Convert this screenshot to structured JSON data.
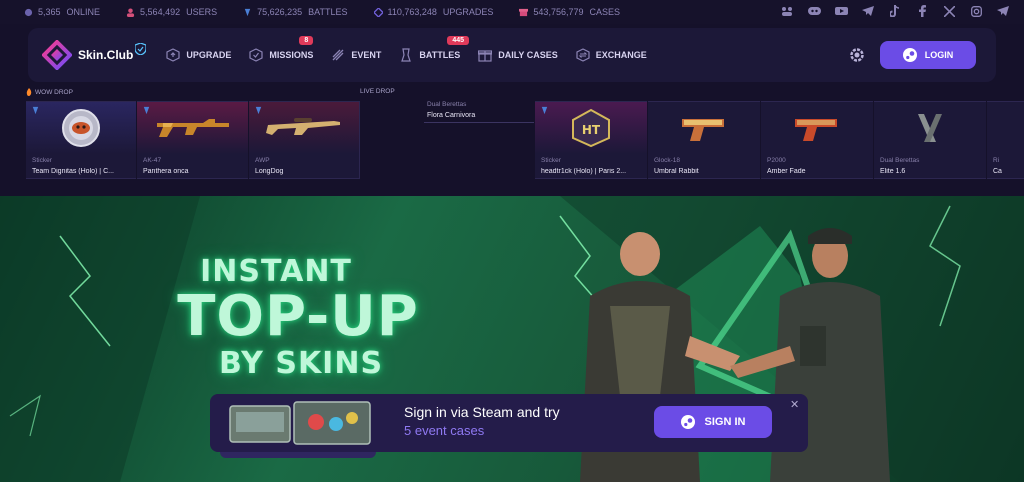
{
  "stats": [
    {
      "num": "5,365",
      "label": "ONLINE",
      "color": "#6b63ad",
      "icon": "online-icon"
    },
    {
      "num": "5,564,492",
      "label": "USERS",
      "color": "#d4507a",
      "icon": "users-icon"
    },
    {
      "num": "75,626,235",
      "label": "BATTLES",
      "color": "#4a7fd6",
      "icon": "battles-icon"
    },
    {
      "num": "110,763,248",
      "label": "UPGRADES",
      "color": "#7060d8",
      "icon": "upgrades-icon"
    },
    {
      "num": "543,756,779",
      "label": "CASES",
      "color": "#d44a7a",
      "icon": "cases-icon"
    }
  ],
  "social_icons": [
    "community-icon",
    "discord-icon",
    "youtube-icon",
    "telegram-icon",
    "tiktok-icon",
    "facebook-icon",
    "x-icon",
    "instagram-icon",
    "telegram-alt-icon"
  ],
  "nav": {
    "logo_text": "Skin.Club",
    "items": [
      {
        "label": "UPGRADE",
        "icon": "upgrade-icon",
        "badge": ""
      },
      {
        "label": "MISSIONS",
        "icon": "missions-icon",
        "badge": "8"
      },
      {
        "label": "EVENT",
        "icon": "event-icon",
        "badge": ""
      },
      {
        "label": "BATTLES",
        "icon": "battles-nav-icon",
        "badge": "445"
      },
      {
        "label": "DAILY CASES",
        "icon": "daily-cases-icon",
        "badge": ""
      },
      {
        "label": "EXCHANGE",
        "icon": "exchange-icon",
        "badge": ""
      }
    ],
    "login_label": "LOGIN"
  },
  "drops": {
    "wow_label": "WOW DROP",
    "live_label": "LIVE DROP",
    "dual_top": {
      "category": "Dual Berettas",
      "name": "Flora Carnivora"
    },
    "cards": [
      {
        "category": "Sticker",
        "name": "Team Dignitas (Holo) | C...",
        "color": "#2a2660"
      },
      {
        "category": "AK-47",
        "name": "Panthera onca",
        "color": "#46183c"
      },
      {
        "category": "AWP",
        "name": "LongDog",
        "color": "#3e1838"
      },
      {
        "category": "Sticker",
        "name": "headtr1ck (Holo) | Paris 2...",
        "color": "#3e1a44"
      },
      {
        "category": "Glock-18",
        "name": "Umbral Rabbit",
        "color": "#3a1a44"
      },
      {
        "category": "P2000",
        "name": "Amber Fade",
        "color": "#2c1a4a"
      },
      {
        "category": "Dual Berettas",
        "name": "Elite 1.6",
        "color": "#28204a"
      },
      {
        "category": "Ri",
        "name": "Ca",
        "color": "#28204a"
      }
    ]
  },
  "hero": {
    "line1": "INSTANT",
    "line2": "TOP-UP",
    "line3": "BY SKINS"
  },
  "signin": {
    "text1": "Sign in via Steam and try",
    "text2": "5 event cases",
    "button": "SIGN IN",
    "close": "✕"
  }
}
